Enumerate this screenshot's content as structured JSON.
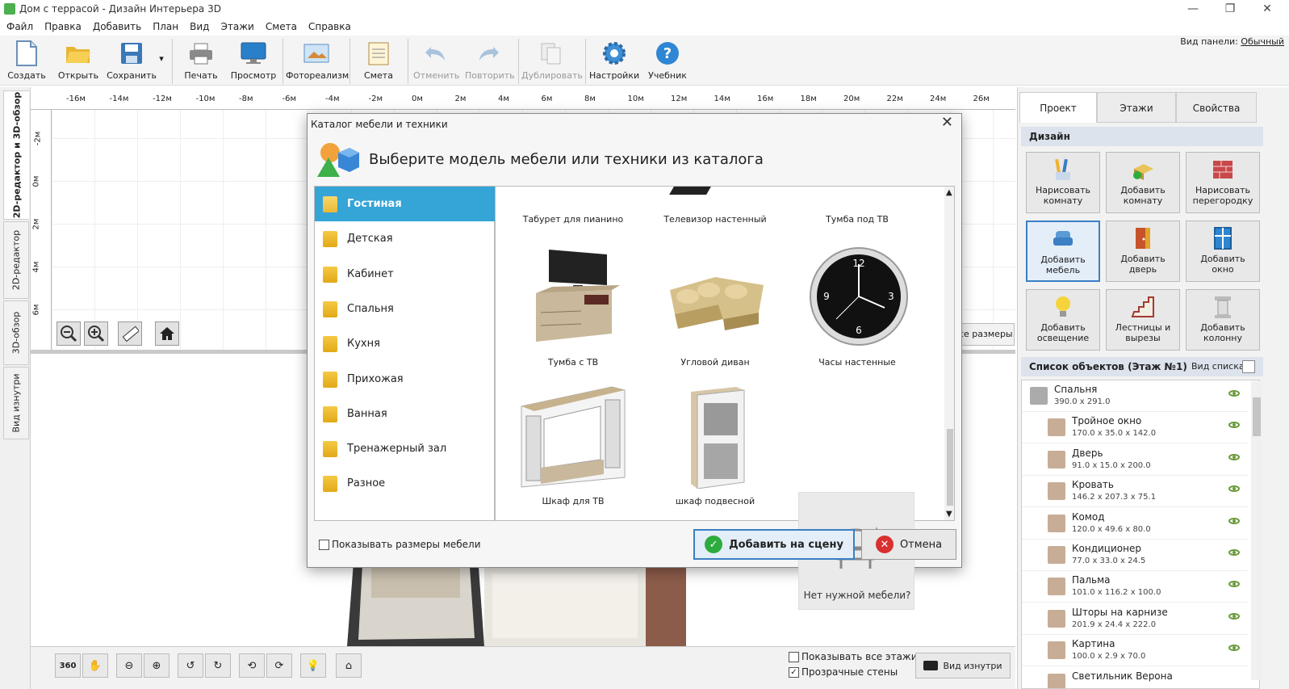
{
  "window": {
    "title": "Дом с террасой - Дизайн Интерьера 3D",
    "min": "—",
    "max": "❐",
    "close": "✕"
  },
  "menu": [
    "Файл",
    "Правка",
    "Добавить",
    "План",
    "Вид",
    "Этажи",
    "Смета",
    "Справка"
  ],
  "toolbar": {
    "create": "Создать",
    "open": "Открыть",
    "save": "Сохранить",
    "print": "Печать",
    "preview": "Просмотр",
    "photoreal": "Фотореализм",
    "estimate": "Смета",
    "undo": "Отменить",
    "redo": "Повторить",
    "duplicate": "Дублировать",
    "settings": "Настройки",
    "tutorial": "Учебник"
  },
  "panel_view": {
    "label": "Вид панели:",
    "value": "Обычный"
  },
  "left_tabs": [
    "2D-редактор и 3D-обзор",
    "2D-редактор",
    "3D-обзор",
    "Вид изнутри"
  ],
  "ruler_top": [
    "-16м",
    "-14м",
    "-12м",
    "-10м",
    "-8м",
    "-6м",
    "-4м",
    "-2м",
    "0м",
    "2м",
    "4м",
    "6м",
    "8м",
    "10м",
    "12м",
    "14м",
    "16м",
    "18м",
    "20м",
    "22м",
    "24м",
    "26м"
  ],
  "ruler_left": [
    "-2м",
    "0м",
    "2м",
    "4м",
    "6м"
  ],
  "editor": {
    "sizes_btn": "се размеры"
  },
  "bottom": {
    "show_all_floors": "Показывать все этажи",
    "transparent_walls": "Прозрачные стены",
    "inside_view": "Вид изнутри",
    "rot360": "360"
  },
  "right_panel": {
    "tabs": [
      "Проект",
      "Этажи",
      "Свойства"
    ],
    "design_header": "Дизайн",
    "design_buttons": [
      {
        "l1": "Нарисовать",
        "l2": "комнату"
      },
      {
        "l1": "Добавить",
        "l2": "комнату"
      },
      {
        "l1": "Нарисовать",
        "l2": "перегородку"
      },
      {
        "l1": "Добавить",
        "l2": "мебель"
      },
      {
        "l1": "Добавить",
        "l2": "дверь"
      },
      {
        "l1": "Добавить",
        "l2": "окно"
      },
      {
        "l1": "Добавить",
        "l2": "освещение"
      },
      {
        "l1": "Лестницы и",
        "l2": "вырезы"
      },
      {
        "l1": "Добавить",
        "l2": "колонну"
      }
    ],
    "list_header": "Список объектов (Этаж №1)",
    "list_view": "Вид списка",
    "objects": [
      {
        "name": "Спальня",
        "dims": "390.0 x 291.0"
      },
      {
        "name": "Тройное окно",
        "dims": "170.0 x 35.0 x 142.0"
      },
      {
        "name": "Дверь",
        "dims": "91.0 x 15.0 x 200.0"
      },
      {
        "name": "Кровать",
        "dims": "146.2 x 207.3 x 75.1"
      },
      {
        "name": "Комод",
        "dims": "120.0 x 49.6 x 80.0"
      },
      {
        "name": "Кондиционер",
        "dims": "77.0 x 33.0 x 24.5"
      },
      {
        "name": "Пальма",
        "dims": "101.0 x 116.2 x 100.0"
      },
      {
        "name": "Шторы на карнизе",
        "dims": "201.9 x 24.4 x 222.0"
      },
      {
        "name": "Картина",
        "dims": "100.0 x 2.9 x 70.0"
      },
      {
        "name": "Светильник Верона",
        "dims": ""
      }
    ]
  },
  "dialog": {
    "title": "Каталог мебели и техники",
    "heading": "Выберите модель мебели или техники из каталога",
    "categories": [
      "Гостиная",
      "Детская",
      "Кабинет",
      "Спальня",
      "Кухня",
      "Прихожая",
      "Ванная",
      "Тренажерный зал",
      "Разное"
    ],
    "top_row": [
      "Табурет для пианино",
      "Телевизор настенный",
      "Тумба под ТВ"
    ],
    "items": [
      "Тумба с ТВ",
      "Угловой диван",
      "Часы настенные",
      "Шкаф для ТВ",
      "шкаф подвесной"
    ],
    "no_furniture": "Нет нужной мебели?",
    "show_sizes": "Показывать размеры мебели",
    "add_btn": "Добавить на сцену",
    "cancel_btn": "Отмена",
    "close": "✕"
  },
  "colors": {
    "accent": "#35a4d6",
    "primary_border": "#3b7fc4",
    "ok_green": "#2eab3e",
    "cancel_red": "#d93030"
  }
}
